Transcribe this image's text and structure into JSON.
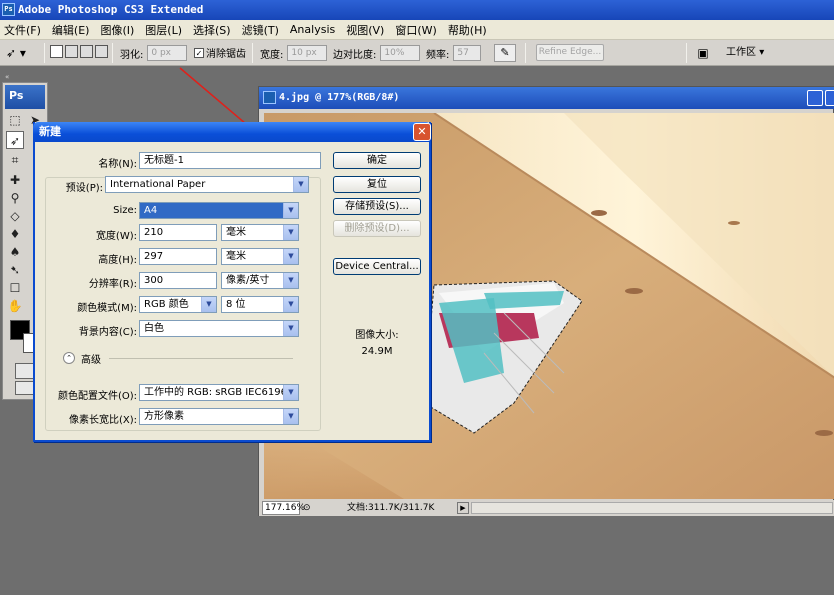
{
  "app": {
    "title": "Adobe Photoshop CS3 Extended",
    "logo": "Ps"
  },
  "menu": [
    "文件(F)",
    "编辑(E)",
    "图像(I)",
    "图层(L)",
    "选择(S)",
    "滤镜(T)",
    "Analysis",
    "视图(V)",
    "窗口(W)",
    "帮助(H)"
  ],
  "options": {
    "feather_label": "羽化:",
    "feather_value": "0 px",
    "antialias_label": "消除锯齿",
    "width_label": "宽度:",
    "width_value": "10 px",
    "contrast_label": "边对比度:",
    "contrast_value": "10%",
    "freq_label": "频率:",
    "freq_value": "57",
    "refine_label": "Refine Edge...",
    "workspace_label": "工作区"
  },
  "toolbox": {
    "header": "Ps"
  },
  "document": {
    "title": "4.jpg @ 177%(RGB/8#)",
    "zoom": "177.16%",
    "doc_size": "文档:311.7K/311.7K"
  },
  "dialog": {
    "title": "新建",
    "name_label": "名称(N):",
    "name_value": "无标题-1",
    "preset_label": "预设(P):",
    "preset_value": "International Paper",
    "size_label": "Size:",
    "size_value": "A4",
    "width_label": "宽度(W):",
    "width_value": "210",
    "width_unit": "毫米",
    "height_label": "高度(H):",
    "height_value": "297",
    "height_unit": "毫米",
    "res_label": "分辨率(R):",
    "res_value": "300",
    "res_unit": "像素/英寸",
    "mode_label": "颜色模式(M):",
    "mode_value": "RGB 颜色",
    "depth_value": "8 位",
    "bg_label": "背景内容(C):",
    "bg_value": "白色",
    "advanced_label": "高级",
    "profile_label": "颜色配置文件(O):",
    "profile_value": "工作中的 RGB: sRGB IEC6196...",
    "aspect_label": "像素长宽比(X):",
    "aspect_value": "方形像素",
    "ok_label": "确定",
    "reset_label": "复位",
    "save_preset_label": "存储预设(S)...",
    "delete_preset_label": "删除预设(D)...",
    "device_central_label": "Device Central...",
    "image_size_label": "图像大小:",
    "image_size_value": "24.9M"
  },
  "colors": {
    "titlebar": "#1746b8",
    "dialog_border": "#0a4bd0",
    "arrow": "#e0201a"
  }
}
